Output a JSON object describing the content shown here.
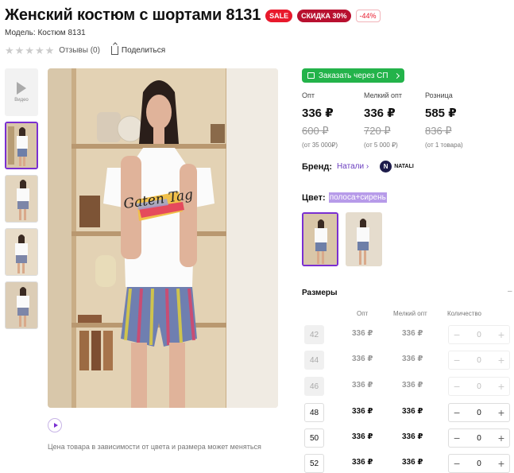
{
  "product": {
    "title": "Женский костюм с шортами 8131",
    "badges": {
      "sale": "SALE",
      "discount": "СКИДКА 30%",
      "percent": "-44%"
    },
    "model": "Модель: Костюм 8131",
    "reviews": "Отзывы (0)",
    "share": "Поделиться"
  },
  "gallery": {
    "video_label": "Видео",
    "note": "Цена товара в зависимости от цвета и размера может меняться",
    "shirt_text": "Gaten Tag"
  },
  "order": {
    "button_label": "Заказать через СП"
  },
  "prices": [
    {
      "label": "Опт",
      "value": "336 ₽",
      "old": "600 ₽",
      "note": "(от 35 000₽)"
    },
    {
      "label": "Мелкий опт",
      "value": "336 ₽",
      "old": "720 ₽",
      "note": "(от 5 000 ₽)"
    },
    {
      "label": "Розница",
      "value": "585 ₽",
      "old": "836 ₽",
      "note": "(от 1 товара)"
    }
  ],
  "brand": {
    "label": "Бренд:",
    "name": "Натали",
    "logo_text": "NATALI",
    "logo_letter": "N"
  },
  "color": {
    "label": "Цвет:",
    "value": "полоса+сирень"
  },
  "sizes": {
    "title": "Размеры",
    "dash": "–",
    "headers": {
      "opt": "Опт",
      "small_opt": "Мелкий опт",
      "quantity": "Количество"
    },
    "rows": [
      {
        "size": "42",
        "opt": "336 ₽",
        "small_opt": "336 ₽",
        "qty": "0",
        "available": false
      },
      {
        "size": "44",
        "opt": "336 ₽",
        "small_opt": "336 ₽",
        "qty": "0",
        "available": false
      },
      {
        "size": "46",
        "opt": "336 ₽",
        "small_opt": "336 ₽",
        "qty": "0",
        "available": false
      },
      {
        "size": "48",
        "opt": "336 ₽",
        "small_opt": "336 ₽",
        "qty": "0",
        "available": true
      },
      {
        "size": "50",
        "opt": "336 ₽",
        "small_opt": "336 ₽",
        "qty": "0",
        "available": true
      },
      {
        "size": "52",
        "opt": "336 ₽",
        "small_opt": "336 ₽",
        "qty": "0",
        "available": true
      }
    ]
  },
  "colors": {
    "accent": "#7a2fd1",
    "sale": "#e8192c",
    "green": "#23b34a"
  }
}
